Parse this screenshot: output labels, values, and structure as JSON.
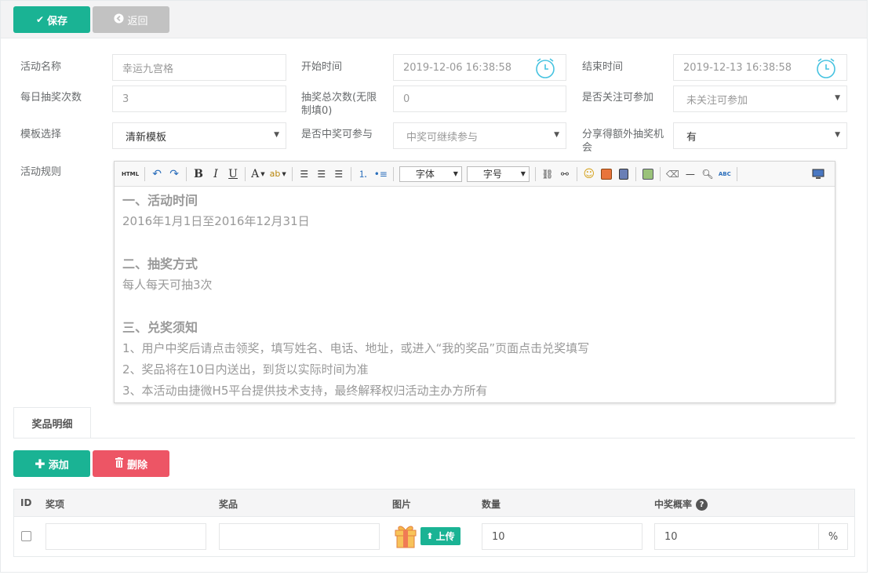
{
  "toolbar": {
    "save_label": "保存",
    "back_label": "返回"
  },
  "form": {
    "activity_name": {
      "label": "活动名称",
      "value": "幸运九宫格"
    },
    "start_time": {
      "label": "开始时间",
      "value": "2019-12-06 16:38:58"
    },
    "end_time": {
      "label": "结束时间",
      "value": "2019-12-13 16:38:58"
    },
    "daily_draws": {
      "label": "每日抽奖次数",
      "value": "3"
    },
    "total_draws": {
      "label": "抽奖总次数(无限制填0)",
      "value": "0"
    },
    "follow_required": {
      "label": "是否关注可参加",
      "value": "未关注可参加"
    },
    "template": {
      "label": "模板选择",
      "value": "清新模板"
    },
    "winner_continue": {
      "label": "是否中奖可参与",
      "value": "中奖可继续参与"
    },
    "share_extra": {
      "label": "分享得额外抽奖机会",
      "value": "有"
    },
    "rules_label": "活动规则"
  },
  "editor": {
    "toolbar": {
      "html_label": "HTML",
      "font_label": "字体",
      "size_label": "字号"
    },
    "content": [
      {
        "type": "h",
        "text": "一、活动时间"
      },
      {
        "type": "p",
        "text": "2016年1月1日至2016年12月31日"
      },
      {
        "type": "blank",
        "text": ""
      },
      {
        "type": "h",
        "text": "二、抽奖方式"
      },
      {
        "type": "p",
        "text": "每人每天可抽3次"
      },
      {
        "type": "blank",
        "text": ""
      },
      {
        "type": "h",
        "text": "三、兑奖须知"
      },
      {
        "type": "p",
        "text": "1、用户中奖后请点击领奖，填写姓名、电话、地址，或进入“我的奖品”页面点击兑奖填写"
      },
      {
        "type": "p",
        "text": "2、奖品将在10日内送出，到货以实际时间为准"
      },
      {
        "type": "p",
        "text": "3、本活动由捷微H5平台提供技术支持，最终解释权归活动主办方所有"
      }
    ]
  },
  "tabs": [
    {
      "label": "奖品明细"
    }
  ],
  "prize_actions": {
    "add_label": "添加",
    "delete_label": "删除"
  },
  "prize_table": {
    "columns": [
      "ID",
      "奖项",
      "奖品",
      "图片",
      "数量",
      "中奖概率"
    ],
    "help_glyph": "?",
    "rows": [
      {
        "award": "",
        "prize": "",
        "upload_label": "上传",
        "quantity": "10",
        "probability": "10",
        "unit": "%"
      }
    ]
  }
}
